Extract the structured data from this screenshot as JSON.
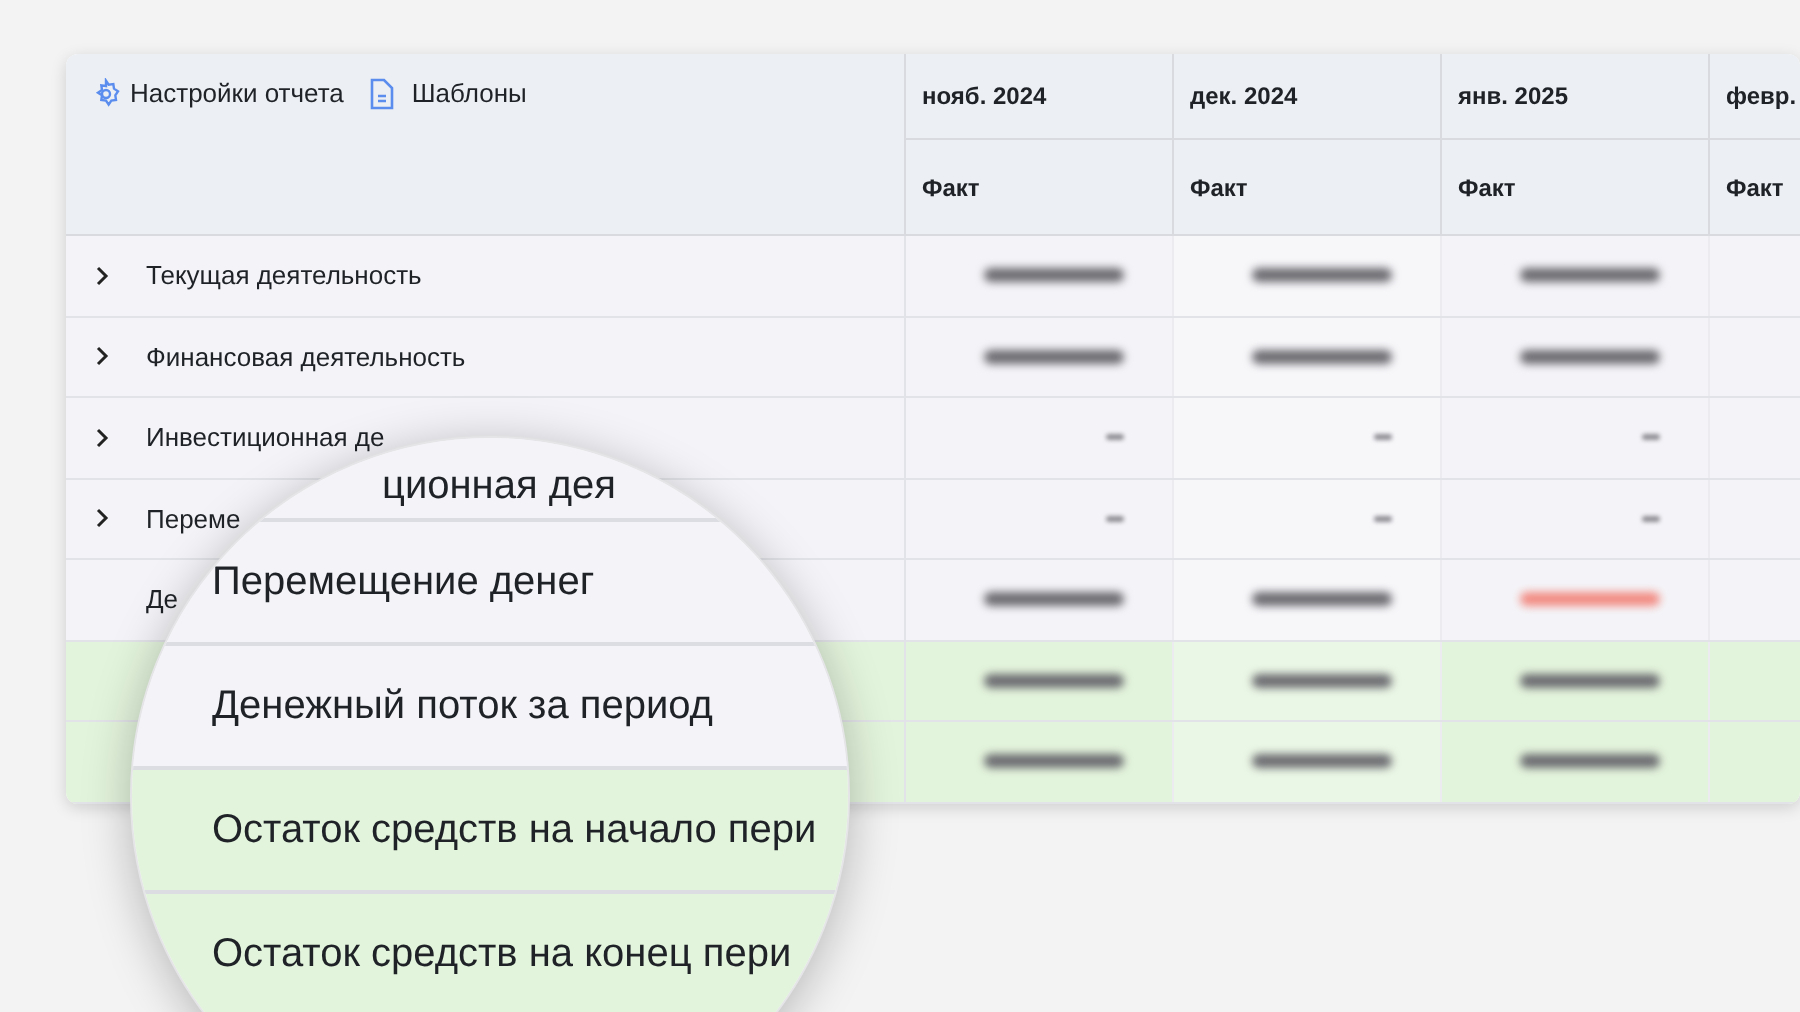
{
  "toolbar": {
    "settings_link": "Настройки отчета",
    "templates_link": "Шаблоны"
  },
  "columns": [
    {
      "month": "нояб. 2024",
      "sub": "Факт"
    },
    {
      "month": "дек. 2024",
      "sub": "Факт"
    },
    {
      "month": "янв. 2025",
      "sub": "Факт"
    },
    {
      "month": "февр.",
      "sub": "Факт"
    }
  ],
  "rows": [
    {
      "label": "Текущая деятельность",
      "expandable": true,
      "highlighted": false,
      "cells": [
        {
          "dash": false,
          "negative": false
        },
        {
          "dash": false,
          "negative": false
        },
        {
          "dash": false,
          "negative": false
        }
      ]
    },
    {
      "label": "Финансовая деятельность",
      "expandable": true,
      "highlighted": false,
      "cells": [
        {
          "dash": false,
          "negative": false
        },
        {
          "dash": false,
          "negative": false
        },
        {
          "dash": false,
          "negative": false
        }
      ]
    },
    {
      "label": "Инвестиционная де",
      "expandable": true,
      "highlighted": false,
      "cells": [
        {
          "dash": true,
          "negative": false
        },
        {
          "dash": true,
          "negative": false
        },
        {
          "dash": true,
          "negative": false
        }
      ]
    },
    {
      "label": "Переме",
      "expandable": true,
      "highlighted": false,
      "cells": [
        {
          "dash": true,
          "negative": false
        },
        {
          "dash": true,
          "negative": false
        },
        {
          "dash": true,
          "negative": false
        }
      ]
    },
    {
      "label": "Де",
      "expandable": false,
      "highlighted": false,
      "cells": [
        {
          "dash": false,
          "negative": false
        },
        {
          "dash": false,
          "negative": false
        },
        {
          "dash": false,
          "negative": true
        }
      ]
    },
    {
      "expandable": false,
      "highlighted": true,
      "cells": [
        {
          "dash": false,
          "negative": false
        },
        {
          "dash": false,
          "negative": false
        },
        {
          "dash": false,
          "negative": false
        }
      ]
    },
    {
      "expandable": false,
      "highlighted": true,
      "cells": [
        {
          "dash": false,
          "negative": false
        },
        {
          "dash": false,
          "negative": false
        },
        {
          "dash": false,
          "negative": false
        }
      ]
    }
  ],
  "magnifier": {
    "rows": [
      {
        "label": "ционная дея",
        "highlighted": false
      },
      {
        "label": "Перемещение денег",
        "highlighted": false
      },
      {
        "label": "Денежный поток за период",
        "highlighted": false
      },
      {
        "label": "Остаток средств на начало пери",
        "highlighted": true
      },
      {
        "label": "Остаток средств на конец пери",
        "highlighted": true
      }
    ]
  }
}
